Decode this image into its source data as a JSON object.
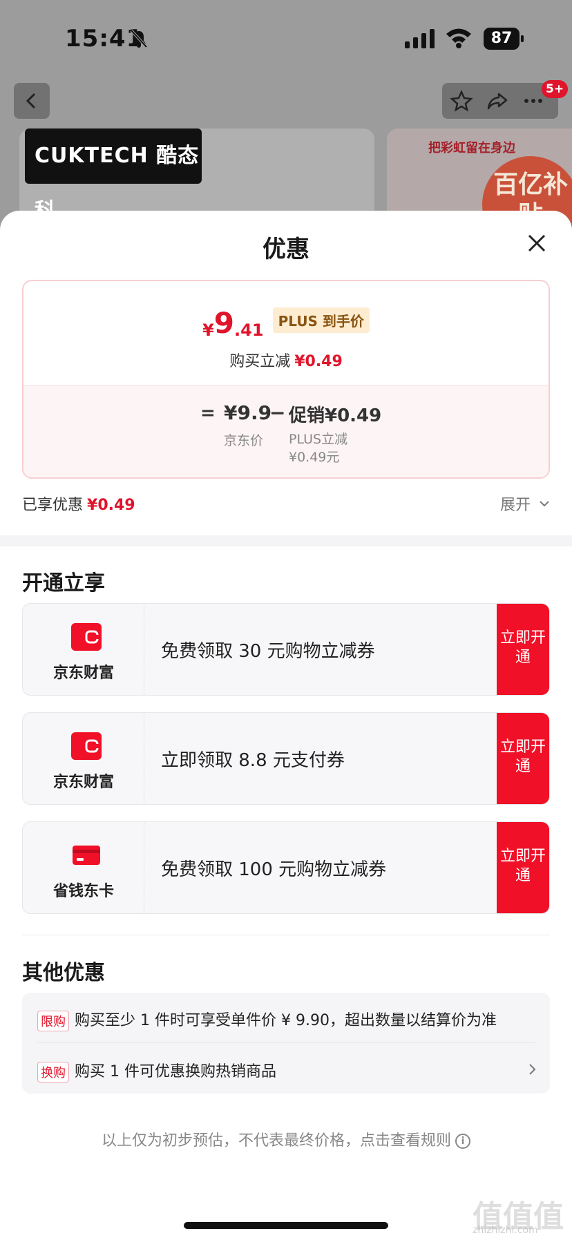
{
  "status": {
    "time": "15:41",
    "battery": "87"
  },
  "nav": {
    "badge": "5+"
  },
  "background": {
    "brand_logo": "CUKTECH 酷态科",
    "banner_text": "把彩虹留在身边",
    "subsidy": "百亿补贴"
  },
  "sheet": {
    "title": "优惠"
  },
  "price_card": {
    "yen": "¥",
    "price_int": "9",
    "price_dec": ".41",
    "plus_tag": "PLUS 到手价",
    "reduce_label": "购买立减",
    "reduce_value": "¥0.49",
    "eq": "=",
    "jd_price": "¥9.9",
    "minus": "−",
    "promo": "促销¥0.49",
    "jd_price_label": "京东价",
    "promo_label_1": "PLUS立减",
    "promo_label_2": "¥0.49元"
  },
  "enjoyed": {
    "label": "已享优惠",
    "value": "¥0.49",
    "expand": "展开"
  },
  "open_section": {
    "title": "开通立享",
    "offers": [
      {
        "name": "京东财富",
        "desc": "免费领取 30 元购物立减券",
        "button": "立即开通",
        "icon": "wallet-icon"
      },
      {
        "name": "京东财富",
        "desc": "立即领取 8.8 元支付券",
        "button": "立即开通",
        "icon": "wallet-icon"
      },
      {
        "name": "省钱东卡",
        "desc": "免费领取 100 元购物立减券",
        "button": "立即开通",
        "icon": "card-icon"
      }
    ]
  },
  "other_section": {
    "title": "其他优惠",
    "rows": [
      {
        "tag": "限购",
        "text": "购买至少 1 件时可享受单件价 ¥ 9.90，超出数量以结算价为准"
      },
      {
        "tag": "换购",
        "text": "购买 1 件可优惠换购热销商品"
      }
    ]
  },
  "disclaimer": "以上仅为初步预估，不代表最终价格，点击查看规则",
  "watermark": {
    "main": "值值值",
    "sub": "zhizhizhi.com"
  },
  "colors": {
    "accent": "#e0142b",
    "button": "#f01028",
    "plus_tag_bg": "#fdecd0"
  }
}
